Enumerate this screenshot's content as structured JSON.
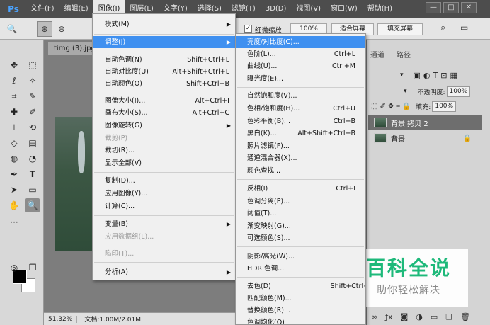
{
  "app": {
    "logo": "Ps"
  },
  "menubar": {
    "items": [
      "文件(F)",
      "编辑(E)",
      "图像(I)",
      "图层(L)",
      "文字(Y)",
      "选择(S)",
      "滤镜(T)",
      "3D(D)",
      "视图(V)",
      "窗口(W)",
      "帮助(H)"
    ],
    "active_index": 2
  },
  "window_controls": {
    "minimize": "—",
    "restore": "□",
    "close": "✕"
  },
  "options": {
    "fine_zoom_label": "细微缩放",
    "zoom_value": "100%",
    "fit_screen": "适合屏幕",
    "fill_screen": "填充屏幕"
  },
  "document": {
    "tab": "timg (3).jpg",
    "zoom": "51.32%",
    "doc_info": "文档:1.00M/2.01M"
  },
  "panels": {
    "tabs": [
      "通道",
      "路径"
    ],
    "opacity_label": "不透明度:",
    "opacity_value": "100%",
    "fill_label": "填充:",
    "fill_value": "100%",
    "lock_label": "锁定:",
    "layers": [
      "背景 拷贝 2",
      "背景"
    ]
  },
  "image_menu": {
    "items": [
      {
        "label": "模式(M)",
        "submenu": true
      },
      {
        "label": "调整(J)",
        "submenu": true,
        "highlight": true
      },
      {
        "label": "自动色调(N)",
        "shortcut": "Shift+Ctrl+L"
      },
      {
        "label": "自动对比度(U)",
        "shortcut": "Alt+Shift+Ctrl+L"
      },
      {
        "label": "自动颜色(O)",
        "shortcut": "Shift+Ctrl+B"
      },
      {
        "label": "图像大小(I)...",
        "shortcut": "Alt+Ctrl+I"
      },
      {
        "label": "画布大小(S)...",
        "shortcut": "Alt+Ctrl+C"
      },
      {
        "label": "图像旋转(G)",
        "submenu": true
      },
      {
        "label": "裁剪(P)",
        "disabled": true
      },
      {
        "label": "裁切(R)..."
      },
      {
        "label": "显示全部(V)"
      },
      {
        "label": "复制(D)..."
      },
      {
        "label": "应用图像(Y)..."
      },
      {
        "label": "计算(C)..."
      },
      {
        "label": "变量(B)",
        "submenu": true
      },
      {
        "label": "应用数据组(L)...",
        "disabled": true
      },
      {
        "label": "陷印(T)...",
        "disabled": true
      },
      {
        "label": "分析(A)",
        "submenu": true
      }
    ]
  },
  "adjust_menu": {
    "items": [
      {
        "label": "亮度/对比度(C)...",
        "highlight": true
      },
      {
        "label": "色阶(L)...",
        "shortcut": "Ctrl+L"
      },
      {
        "label": "曲线(U)...",
        "shortcut": "Ctrl+M"
      },
      {
        "label": "曝光度(E)..."
      },
      {
        "label": "自然饱和度(V)..."
      },
      {
        "label": "色相/饱和度(H)...",
        "shortcut": "Ctrl+U"
      },
      {
        "label": "色彩平衡(B)...",
        "shortcut": "Ctrl+B"
      },
      {
        "label": "黑白(K)...",
        "shortcut": "Alt+Shift+Ctrl+B"
      },
      {
        "label": "照片滤镜(F)..."
      },
      {
        "label": "通道混合器(X)..."
      },
      {
        "label": "颜色查找..."
      },
      {
        "label": "反相(I)",
        "shortcut": "Ctrl+I"
      },
      {
        "label": "色调分离(P)..."
      },
      {
        "label": "阈值(T)..."
      },
      {
        "label": "渐变映射(G)..."
      },
      {
        "label": "可选颜色(S)..."
      },
      {
        "label": "阴影/高光(W)..."
      },
      {
        "label": "HDR 色调..."
      },
      {
        "label": "去色(D)",
        "shortcut": "Shift+Ctrl+U"
      },
      {
        "label": "匹配颜色(M)..."
      },
      {
        "label": "替换颜色(R)..."
      },
      {
        "label": "色调均化(Q)"
      }
    ]
  },
  "watermark": {
    "main": "百科全说",
    "sub": "助你轻松解决"
  },
  "colors": {
    "menu_highlight": "#3f90f0",
    "watermark_green": "#1eb97a",
    "menubar_bg": "#4d4d4d"
  }
}
